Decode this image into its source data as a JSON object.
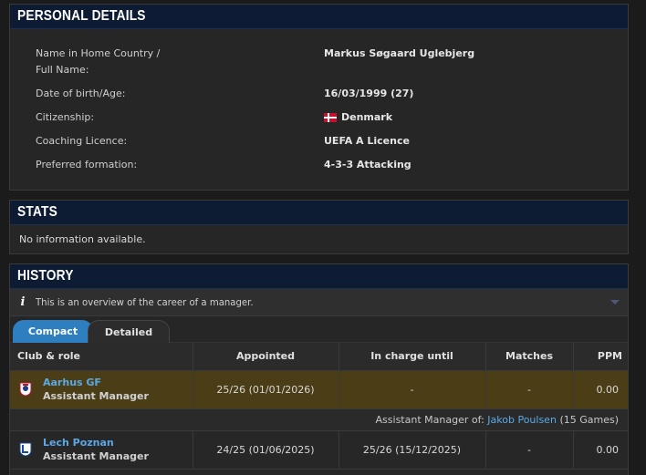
{
  "personal": {
    "title": "PERSONAL DETAILS",
    "rows": [
      {
        "label_line1": "Name in Home Country /",
        "label_line2": "Full Name:",
        "value": "Markus Søgaard Uglebjerg"
      },
      {
        "label_line1": "Date of birth/Age:",
        "value": "16/03/1999 (27)"
      },
      {
        "label_line1": "Citizenship:",
        "value": "Denmark",
        "flag": "denmark-flag-icon"
      },
      {
        "label_line1": "Coaching Licence:",
        "value": "UEFA A Licence"
      },
      {
        "label_line1": "Preferred formation:",
        "value": "4-3-3 Attacking"
      }
    ]
  },
  "stats": {
    "title": "STATS",
    "empty_text": "No information available."
  },
  "history": {
    "title": "HISTORY",
    "info_text": "This is an overview of the career of a manager.",
    "tabs": [
      {
        "label": "Compact",
        "active": true
      },
      {
        "label": "Detailed",
        "active": false
      }
    ],
    "columns": [
      "Club & role",
      "Appointed",
      "In charge until",
      "Matches",
      "PPM"
    ],
    "rows": [
      {
        "club": "Aarhus GF",
        "role": "Assistant Manager",
        "appointed": "25/26 (01/01/2026)",
        "until": "-",
        "matches": "-",
        "ppm": "0.00",
        "highlight": true,
        "note_prefix": "Assistant Manager of:",
        "note_link": "Jakob Poulsen",
        "note_suffix": "(15 Games)"
      },
      {
        "club": "Lech Poznan",
        "role": "Assistant Manager",
        "appointed": "24/25 (01/06/2025)",
        "until": "25/26 (15/12/2025)",
        "matches": "-",
        "ppm": "0.00",
        "highlight": false
      }
    ]
  },
  "colors": {
    "header_bg": "#0d1b33",
    "accent": "#2e7fc0",
    "link": "#5aa9e6",
    "highlight_row": "#4b3e17"
  }
}
